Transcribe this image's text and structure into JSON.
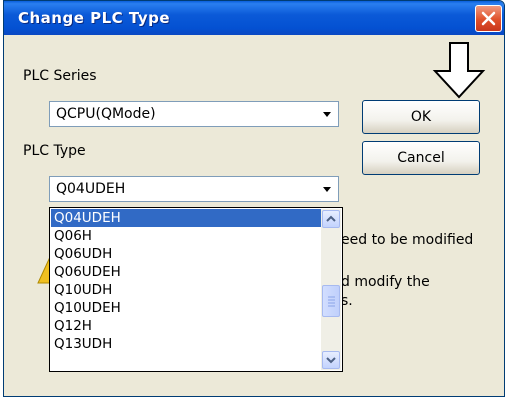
{
  "window": {
    "title": "Change PLC Type"
  },
  "plc_series": {
    "label": "PLC Series",
    "value": "QCPU(QMode)"
  },
  "plc_type": {
    "label": "PLC Type",
    "value": "Q04UDEH",
    "options": [
      "Q04UDEH",
      "Q06H",
      "Q06UDH",
      "Q06UDEH",
      "Q10UDH",
      "Q10UDEH",
      "Q12H",
      "Q13UDH"
    ],
    "selected_index": 0
  },
  "buttons": {
    "ok": "OK",
    "cancel": "Cancel"
  },
  "notice": {
    "line1": "eed to be modified",
    "line2": "d modify the",
    "line3": "s."
  },
  "colors": {
    "title_bar": "#0451d2",
    "selection": "#316ac5",
    "dialog_bg": "#ece9d8"
  }
}
